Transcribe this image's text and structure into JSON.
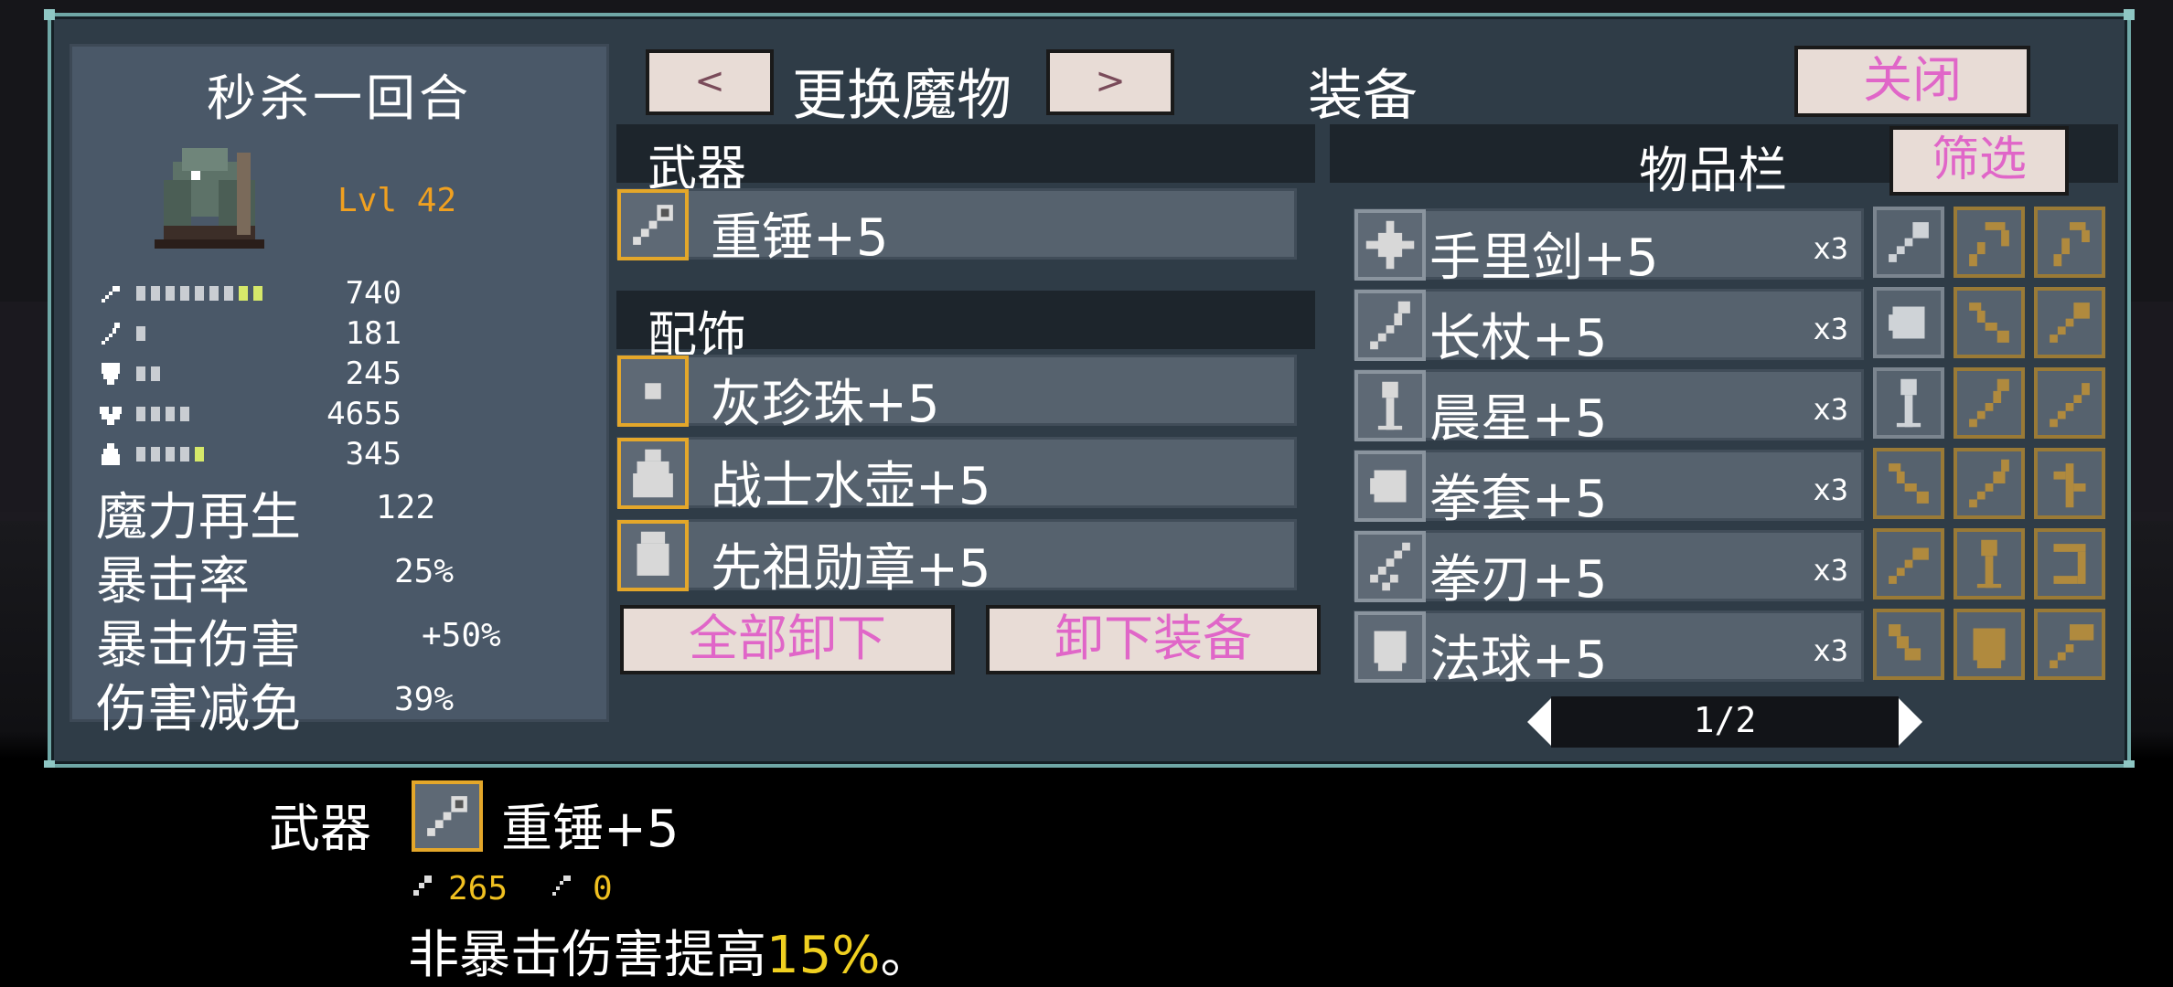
{
  "colors": {
    "accent_gold": "#e4a72a",
    "button_bg": "#e8dcd6",
    "button_text": "#e066c8",
    "level_text": "#f0a020",
    "window_bg": "#2f3c47"
  },
  "monster": {
    "name": "秒杀一回合",
    "level": "Lvl 42",
    "stats": [
      {
        "icon": "sword-icon",
        "value": "740",
        "fill": 0.55,
        "highlight": 0.2
      },
      {
        "icon": "staff-icon",
        "value": "181",
        "fill": 0.05,
        "highlight": 0
      },
      {
        "icon": "shield-icon",
        "value": "245",
        "fill": 0.2,
        "highlight": 0
      },
      {
        "icon": "heart-icon",
        "value": "4655",
        "fill": 0.32,
        "highlight": 0
      },
      {
        "icon": "flask-icon",
        "value": "345",
        "fill": 0.32,
        "highlight": 0.06
      }
    ],
    "text_stats": [
      {
        "label": "魔力再生",
        "value": "122"
      },
      {
        "label": "暴击率",
        "value": "25%"
      },
      {
        "label": "暴击伤害",
        "value": "+50%"
      },
      {
        "label": "伤害减免",
        "value": "39%"
      }
    ]
  },
  "header": {
    "prev_label": "<",
    "change_monster": "更换魔物",
    "next_label": ">",
    "equipment_title": "装备",
    "close_label": "关闭"
  },
  "equipment": {
    "weapon_header": "武器",
    "weapon": {
      "name": "重锤+5",
      "icon": "mace-icon"
    },
    "accessory_header": "配饰",
    "accessories": [
      {
        "name": "灰珍珠+5",
        "icon": "pearl-icon"
      },
      {
        "name": "战士水壶+5",
        "icon": "flask-icon"
      },
      {
        "name": "先祖勋章+5",
        "icon": "medal-icon"
      }
    ],
    "unequip_all": "全部卸下",
    "unequip": "卸下装备"
  },
  "inventory": {
    "title": "物品栏",
    "filter_label": "筛选",
    "items": [
      {
        "name": "手里剑+5",
        "qty": "x3",
        "icon": "shuriken-icon"
      },
      {
        "name": "长杖+5",
        "qty": "x3",
        "icon": "staff-icon"
      },
      {
        "name": "晨星+5",
        "qty": "x3",
        "icon": "morningstar-icon"
      },
      {
        "name": "拳套+5",
        "qty": "x3",
        "icon": "gauntlet-icon"
      },
      {
        "name": "拳刃+5",
        "qty": "x3",
        "icon": "claw-icon"
      },
      {
        "name": "法球+5",
        "qty": "x3",
        "icon": "orb-icon"
      }
    ],
    "grid": [
      [
        {
          "icon": "mace-icon",
          "frame": "grey"
        },
        {
          "icon": "whip-icon",
          "frame": "gold"
        },
        {
          "icon": "cane-icon",
          "frame": "gold"
        }
      ],
      [
        {
          "icon": "gauntlet-icon",
          "frame": "grey"
        },
        {
          "icon": "bow-icon",
          "frame": "gold"
        },
        {
          "icon": "mace-icon",
          "frame": "gold"
        }
      ],
      [
        {
          "icon": "morningstar-icon",
          "frame": "grey"
        },
        {
          "icon": "staff-icon",
          "frame": "gold"
        },
        {
          "icon": "wand-icon",
          "frame": "gold"
        }
      ],
      [
        {
          "icon": "bow-icon",
          "frame": "gold"
        },
        {
          "icon": "spear-icon",
          "frame": "gold"
        },
        {
          "icon": "branch-icon",
          "frame": "gold"
        }
      ],
      [
        {
          "icon": "sword-icon",
          "frame": "gold"
        },
        {
          "icon": "morningstar-icon",
          "frame": "gold"
        },
        {
          "icon": "harp-icon",
          "frame": "gold"
        }
      ],
      [
        {
          "icon": "horn-icon",
          "frame": "gold"
        },
        {
          "icon": "orb-icon",
          "frame": "gold"
        },
        {
          "icon": "hammer-icon",
          "frame": "gold"
        }
      ]
    ],
    "page_label": "1/2"
  },
  "tooltip": {
    "category": "武器",
    "name": "重锤+5",
    "attack": "265",
    "magic": "0",
    "desc_before": "非暴击伤害提高",
    "desc_highlight": "15%",
    "desc_after": "。"
  }
}
